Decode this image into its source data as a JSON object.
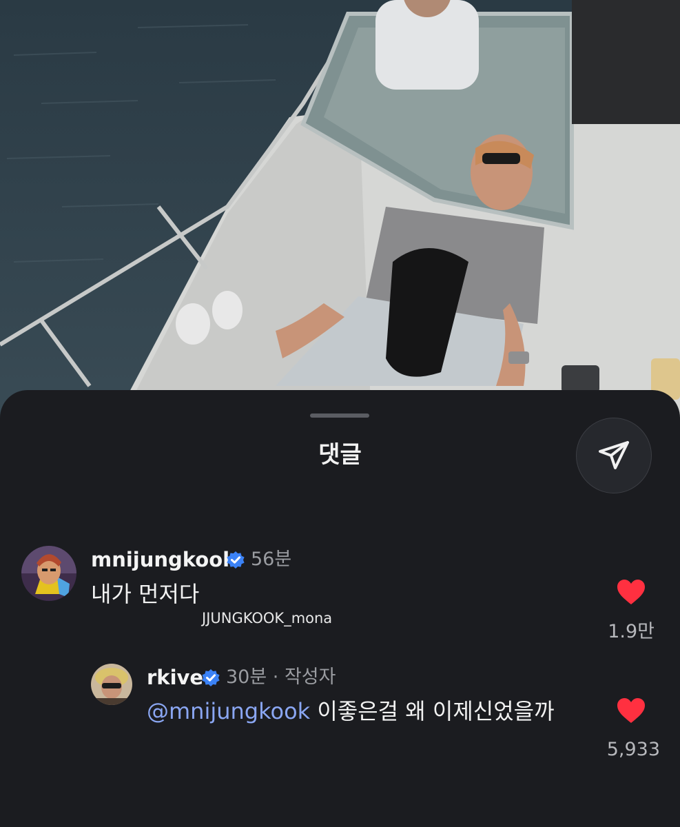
{
  "sheet": {
    "title": "댓글",
    "share_icon": "send-icon"
  },
  "comments": [
    {
      "username": "mnijungkook",
      "verified": true,
      "time": "56분",
      "text": "내가 먼저다",
      "likes": "1.9만",
      "liked": true
    },
    {
      "username": "rkive",
      "verified": true,
      "time": "30분 · 작성자",
      "mention": "@mnijungkook",
      "text": " 이좋은걸 왜 이제신었을까",
      "likes": "5,933",
      "liked": true
    }
  ],
  "watermark": "JJUNGKOOK_mona",
  "colors": {
    "background": "#1b1c20",
    "mention": "#8aa6f2",
    "heart": "#ff3040",
    "verified": "#3b82f6"
  }
}
